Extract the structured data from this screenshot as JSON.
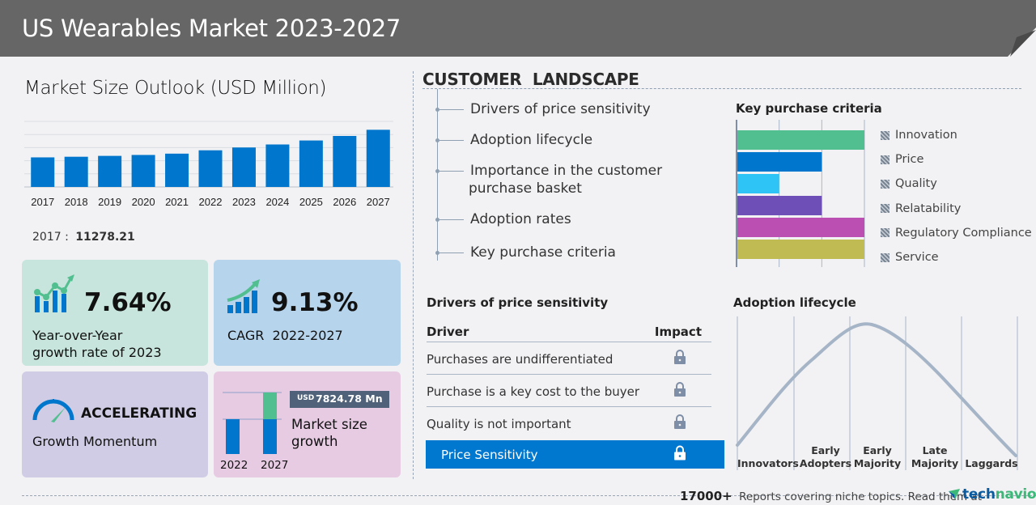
{
  "header": {
    "title": "US Wearables Market 2023-2027"
  },
  "market_outlook": {
    "title": "Market Size Outlook (USD Million)",
    "base_year_label": "2017 :",
    "base_year_value": "11278.21"
  },
  "chart_data": {
    "type": "bar",
    "title": "Market Size Outlook (USD Million)",
    "categories": [
      "2017",
      "2018",
      "2019",
      "2020",
      "2021",
      "2022",
      "2023",
      "2024",
      "2025",
      "2026",
      "2027"
    ],
    "values": [
      11278.21,
      11520,
      11850,
      12200,
      12700,
      13980,
      15050,
      16200,
      17720,
      19450,
      21800
    ],
    "xlabel": "",
    "ylabel": "",
    "ylim": [
      0,
      25000
    ],
    "grid": true,
    "bar_color": "#0077cc"
  },
  "cards": {
    "yoy": {
      "value": "7.64%",
      "label_line1": "Year-over-Year",
      "label_line2": "growth rate of 2023",
      "icon": "growth-chart-icon"
    },
    "cagr": {
      "value": "9.13%",
      "label": "CAGR  2022-2027",
      "icon": "rising-bars-icon"
    },
    "momentum": {
      "value": "ACCELERATING",
      "label": "Growth Momentum",
      "icon": "speedometer-icon"
    },
    "growth": {
      "currency": "USD",
      "value": "7824.78 Mn",
      "label_line1": "Market size",
      "label_line2": "growth",
      "year_start": "2022",
      "year_end": "2027"
    }
  },
  "customer_landscape": {
    "title": "CUSTOMER  LANDSCAPE",
    "items": [
      "Drivers of price sensitivity",
      "Adoption lifecycle",
      "Importance in the customer",
      "purchase basket",
      "Adoption rates",
      "Key purchase criteria"
    ]
  },
  "key_purchase_criteria": {
    "title": "Key purchase criteria",
    "scale_max": 3,
    "items": [
      {
        "label": "Innovation",
        "value": 3,
        "color": "#52bf90"
      },
      {
        "label": "Price",
        "value": 2,
        "color": "#0077cc"
      },
      {
        "label": "Quality",
        "value": 1,
        "color": "#2ec4f5"
      },
      {
        "label": "Relatability",
        "value": 2,
        "color": "#6e4fb8"
      },
      {
        "label": "Regulatory Compliance",
        "value": 3,
        "color": "#bb4fb2"
      },
      {
        "label": "Service",
        "value": 3,
        "color": "#c0bb52"
      }
    ]
  },
  "drivers": {
    "title": "Drivers of price sensitivity",
    "col_driver": "Driver",
    "col_impact": "Impact",
    "rows": [
      "Purchases are undifferentiated",
      "Purchase is a key cost to the buyer",
      "Quality is not important"
    ],
    "total_label": "Price Sensitivity",
    "impact_icon": "lock-icon"
  },
  "adoption": {
    "title": "Adoption lifecycle",
    "stages": [
      {
        "line1": "",
        "line2": "Innovators"
      },
      {
        "line1": "Early",
        "line2": "Adopters"
      },
      {
        "line1": "Early",
        "line2": "Majority"
      },
      {
        "line1": "Late",
        "line2": "Majority"
      },
      {
        "line1": "",
        "line2": "Laggards"
      }
    ]
  },
  "footer": {
    "count": "17000+",
    "text": "Reports covering niche topics. Read them at",
    "brand_part1": "tech",
    "brand_part2": "navio"
  }
}
